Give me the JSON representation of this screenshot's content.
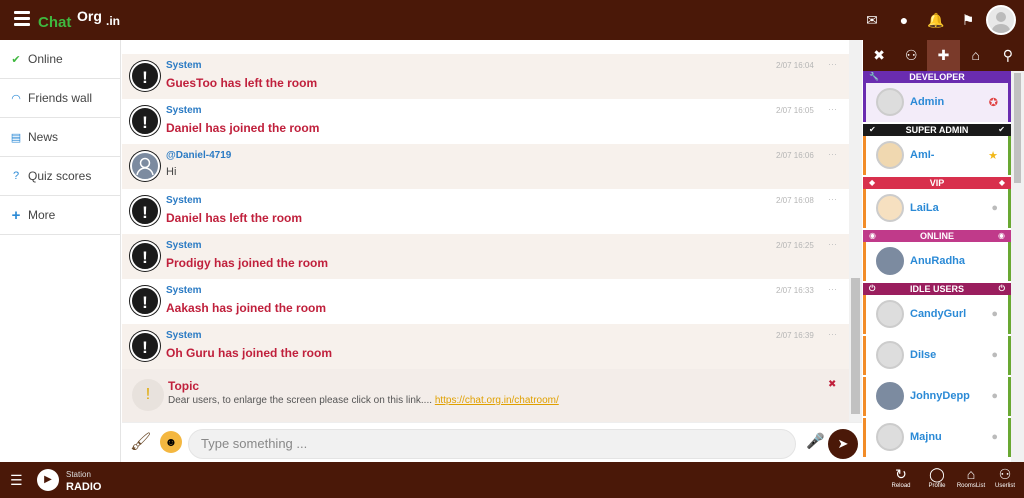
{
  "app": {
    "logo_part1": "Chat",
    "logo_part2": "Org",
    "logo_part3": ".in"
  },
  "topbar": {
    "menu_icon": "hamburger-icon",
    "icons": [
      "envelope-icon",
      "user-icon",
      "bell-icon",
      "flag-icon",
      "avatar"
    ]
  },
  "sidebar": {
    "items": [
      {
        "label": "Online",
        "icon": "check-circle-icon",
        "color": "#3fb83f"
      },
      {
        "label": "Friends wall",
        "icon": "rss-icon",
        "color": "#2b8ad6"
      },
      {
        "label": "News",
        "icon": "newspaper-icon",
        "color": "#2b8ad6"
      },
      {
        "label": "Quiz scores",
        "icon": "question-circle-icon",
        "color": "#2b8ad6"
      },
      {
        "label": "More",
        "icon": "plus-icon",
        "color": "#2b8ad6"
      }
    ]
  },
  "messages": [
    {
      "user": "System",
      "text": "GuesToo has left the room",
      "time": "2/07 16:04",
      "alt": true
    },
    {
      "user": "System",
      "text": "Daniel has joined the room",
      "time": "2/07 16:05",
      "alt": false
    },
    {
      "user": "@Daniel-4719",
      "text": "Hi",
      "time": "2/07 16:06",
      "alt": true
    },
    {
      "user": "System",
      "text": "Daniel has left the room",
      "time": "2/07 16:08",
      "alt": false
    },
    {
      "user": "System",
      "text": "Prodigy has joined the room",
      "time": "2/07 16:25",
      "alt": true
    },
    {
      "user": "System",
      "text": "Aakash has joined the room",
      "time": "2/07 16:33",
      "alt": false
    },
    {
      "user": "System",
      "text": "Oh Guru has joined the room",
      "time": "2/07 16:39",
      "alt": true
    }
  ],
  "topic": {
    "title": "Topic",
    "text": "Dear users, to enlarge the screen please click on this link....",
    "link": "https://chat.org.in/chatroom/"
  },
  "composer": {
    "placeholder": "Type something ..."
  },
  "right_panel": {
    "tabs": [
      "close-icon",
      "users-icon",
      "add-user-icon",
      "home-icon",
      "search-icon"
    ],
    "groups": [
      {
        "rank": "DEVELOPER",
        "color": "#6a2cb0",
        "users": [
          {
            "name": "Admin",
            "badge": "✪"
          }
        ]
      },
      {
        "rank": "SUPER ADMIN",
        "color": "#1a1a1a",
        "users": [
          {
            "name": "AmI-",
            "badge": "★"
          }
        ]
      },
      {
        "rank": "VIP",
        "color": "#d8304d",
        "users": [
          {
            "name": "LaiLa",
            "badge": "◒"
          }
        ]
      },
      {
        "rank": "ONLINE",
        "color": "#c03a8a",
        "users": [
          {
            "name": "AnuRadha",
            "badge": ""
          }
        ]
      },
      {
        "rank": "IDLE USERS",
        "color": "#9a1e5e",
        "users": [
          {
            "name": "CandyGurl",
            "badge": "◒"
          },
          {
            "name": "DiIse",
            "badge": "◒"
          },
          {
            "name": "JohnyDepp",
            "badge": "◒"
          },
          {
            "name": "Majnu",
            "badge": "◒"
          }
        ]
      }
    ]
  },
  "bottombar": {
    "station_label": "Station",
    "radio_label": "RADIO",
    "buttons": [
      {
        "label": "Reload",
        "icon": "reload-icon"
      },
      {
        "label": "Profile",
        "icon": "profile-icon"
      },
      {
        "label": "RoomsList",
        "icon": "home-icon"
      },
      {
        "label": "Userlist",
        "icon": "users-icon"
      }
    ]
  }
}
